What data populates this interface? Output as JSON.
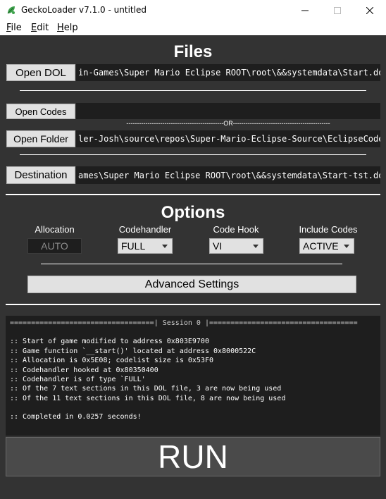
{
  "window": {
    "title": "GeckoLoader v7.1.0 - untitled",
    "icon": "gecko-leaf-icon",
    "accent": "#3fa34d"
  },
  "menu": {
    "file": {
      "accel": "F",
      "rest": "ile"
    },
    "edit": {
      "accel": "E",
      "rest": "dit"
    },
    "help": {
      "accel": "H",
      "rest": "elp"
    }
  },
  "files": {
    "heading": "Files",
    "open_dol_label": "Open DOL",
    "open_dol_path": "in-Games\\Super Mario Eclipse ROOT\\root\\&&systemdata\\Start.dol",
    "open_codes_label": "Open Codes",
    "open_codes_path": "",
    "or_separator": "----------------------------------------------OR----------------------------------------------",
    "open_folder_label": "Open Folder",
    "open_folder_path": "ler-Josh\\source\\repos\\Super-Mario-Eclipse-Source\\EclipseCodes",
    "destination_label": "Destination",
    "destination_path": "ames\\Super Mario Eclipse ROOT\\root\\&&systemdata\\Start-tst.dol"
  },
  "options": {
    "heading": "Options",
    "allocation_label": "Allocation",
    "allocation_value": "AUTO",
    "codehandler_label": "Codehandler",
    "codehandler_value": "FULL",
    "codehook_label": "Code Hook",
    "codehook_value": "VI",
    "include_label": "Include Codes",
    "include_value": "ACTIVE",
    "advanced_label": "Advanced Settings"
  },
  "log": {
    "session_line": "==================================| Session 0 |===================================",
    "lines": [
      ":: Start of game modified to address 0x803E9700",
      ":: Game function `__start()' located at address 0x8000522C",
      ":: Allocation is 0x5E08; codelist size is 0x53F0",
      ":: Codehandler hooked at 0x80350400",
      ":: Codehandler is of type `FULL'",
      ":: Of the 7 text sections in this DOL file, 3 are now being used",
      ":: Of the 11 text sections in this DOL file, 8 are now being used",
      "",
      ":: Completed in 0.0257 seconds!"
    ]
  },
  "run_label": "RUN"
}
